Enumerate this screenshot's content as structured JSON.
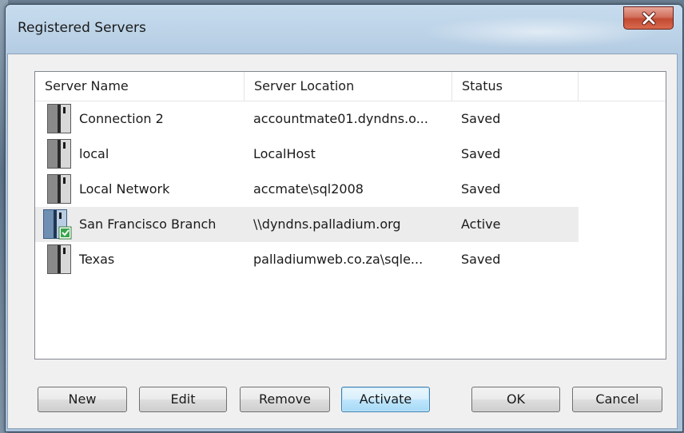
{
  "window": {
    "title": "Registered Servers"
  },
  "columns": [
    {
      "label": "Server Name"
    },
    {
      "label": "Server Location"
    },
    {
      "label": "Status"
    }
  ],
  "servers": [
    {
      "name": "Connection 2",
      "location": "accountmate01.dyndns.o...",
      "status": "Saved",
      "icon": "server-icon"
    },
    {
      "name": "local",
      "location": "LocalHost",
      "status": "Saved",
      "icon": "server-icon"
    },
    {
      "name": "Local Network",
      "location": "accmate\\sql2008",
      "status": "Saved",
      "icon": "server-icon"
    },
    {
      "name": "San Francisco Branch",
      "location": "\\\\dyndns.palladium.org",
      "status": "Active",
      "icon": "server-active-icon"
    },
    {
      "name": "Texas",
      "location": "palladiumweb.co.za\\sqle...",
      "status": "Saved",
      "icon": "server-icon"
    }
  ],
  "buttons": {
    "new": "New",
    "edit": "Edit",
    "remove": "Remove",
    "activate": "Activate",
    "ok": "OK",
    "cancel": "Cancel"
  },
  "colors": {
    "selected_row": "#ececec",
    "active_check": "#3aa54a",
    "close_button": "#c24a32"
  }
}
